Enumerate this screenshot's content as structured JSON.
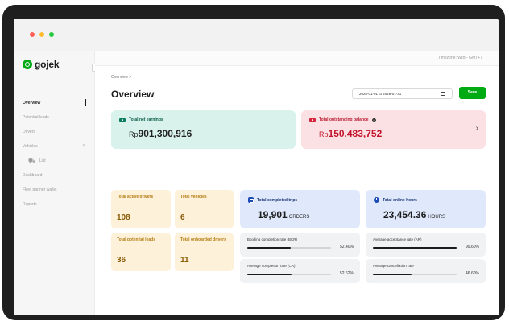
{
  "timezone": "Timezone: WIB - GMT+7",
  "sidebar": {
    "logo": "gojek",
    "collapse": "‹",
    "items": [
      {
        "label": "Overview"
      },
      {
        "label": "Potential leads"
      },
      {
        "label": "Drivers"
      },
      {
        "label": "Vehicles",
        "chevron": "^"
      },
      {
        "label": "List",
        "icon": "⛟"
      },
      {
        "label": "Dashboard"
      },
      {
        "label": "Fleet partner wallet"
      },
      {
        "label": "Reports"
      }
    ]
  },
  "breadcrumb": "Overview  >",
  "page_title": "Overview",
  "date_range": "2026-01-01 to 2026-01-31",
  "save_label": "Save",
  "earnings": {
    "label": "Total net earnings",
    "currency": "Rp",
    "amount": "901,300,916"
  },
  "outstanding": {
    "label": "Total outstanding balance",
    "info": "i",
    "currency": "Rp",
    "amount": "150,483,752",
    "chevron": "›"
  },
  "tiles": [
    {
      "label": "Total active drivers",
      "value": "108"
    },
    {
      "label": "Total vehicles",
      "value": "6"
    },
    {
      "label": "Total potential leads",
      "value": "36"
    },
    {
      "label": "Total onboarded drivers",
      "value": "11"
    }
  ],
  "trips": {
    "label": "Total completed trips",
    "value": "19,901",
    "unit": "ORDERS"
  },
  "hours": {
    "label": "Total online hours",
    "value": "23,454.36",
    "unit": "HOURS"
  },
  "rates": [
    {
      "label": "Booking completion rate (BCR)",
      "value": "52.40%",
      "fraction": 0.524
    },
    {
      "label": "Average acceptance rate (AR)",
      "value": "99.60%",
      "fraction": 0.996
    },
    {
      "label": "Average completion rate (CR)",
      "value": "52.62%",
      "fraction": 0.5262
    },
    {
      "label": "Average cancellation rate",
      "value": "46.60%",
      "fraction": 0.466
    }
  ],
  "colors": {
    "brand": "#00aa13",
    "earnings_bg": "#d9f3ec",
    "outstanding_bg": "#fbe1e4",
    "tile_bg": "#fdf2d9",
    "blue_bg": "#dfe9fb"
  }
}
